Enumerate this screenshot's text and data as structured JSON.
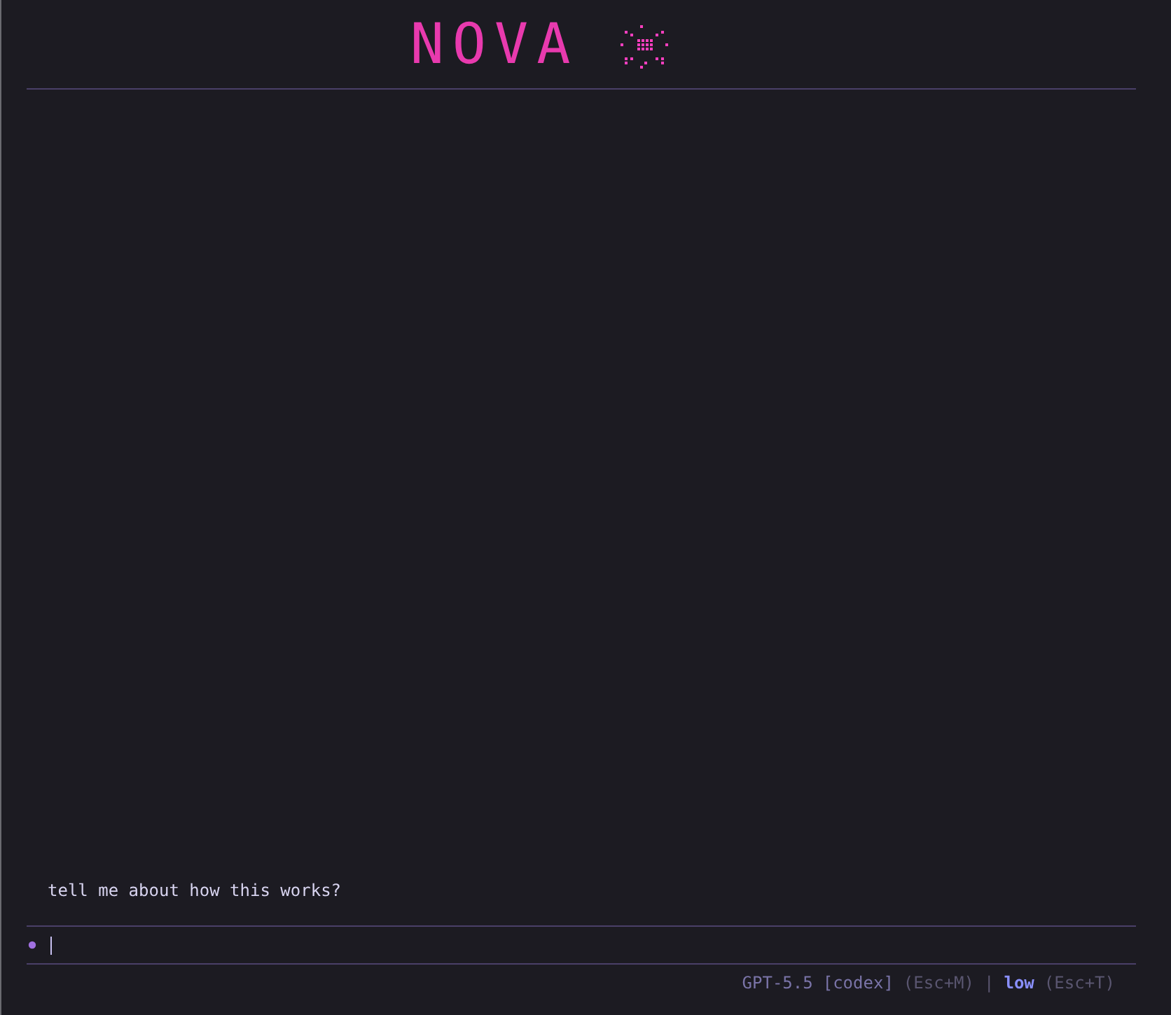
{
  "header": {
    "logo": "NOVA"
  },
  "messages": [
    {
      "text": "tell me about how this works?"
    }
  ],
  "status_bar": {
    "model": "GPT-5.5",
    "provider": "[codex]",
    "model_shortcut": "(Esc+M)",
    "separator": "|",
    "effort": "low",
    "effort_shortcut": "(Esc+T)"
  }
}
